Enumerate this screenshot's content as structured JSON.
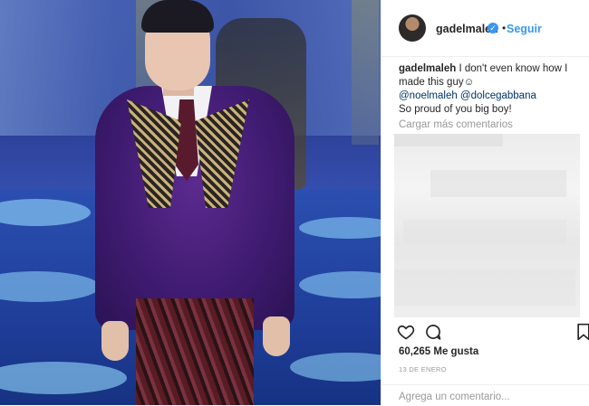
{
  "header": {
    "username": "gadelmaleh",
    "follow_label": "Seguir",
    "separator": "•"
  },
  "caption": {
    "username": "gadelmaleh",
    "text": "I don't even know how I made this guy☺",
    "mentions": "@noelmaleh @dolcegabbana",
    "line3": "So proud of you big boy!"
  },
  "comments": {
    "load_more": "Cargar más comentarios"
  },
  "stats": {
    "likes": "60,265 Me gusta",
    "date": "13 DE ENERO"
  },
  "comment_box": {
    "placeholder": "Agrega un comentario..."
  },
  "colors": {
    "accent": "#3897f0",
    "text": "#262626",
    "muted": "#999999"
  },
  "icons": [
    "heart-icon",
    "comment-icon",
    "bookmark-icon",
    "verified-badge-icon"
  ]
}
